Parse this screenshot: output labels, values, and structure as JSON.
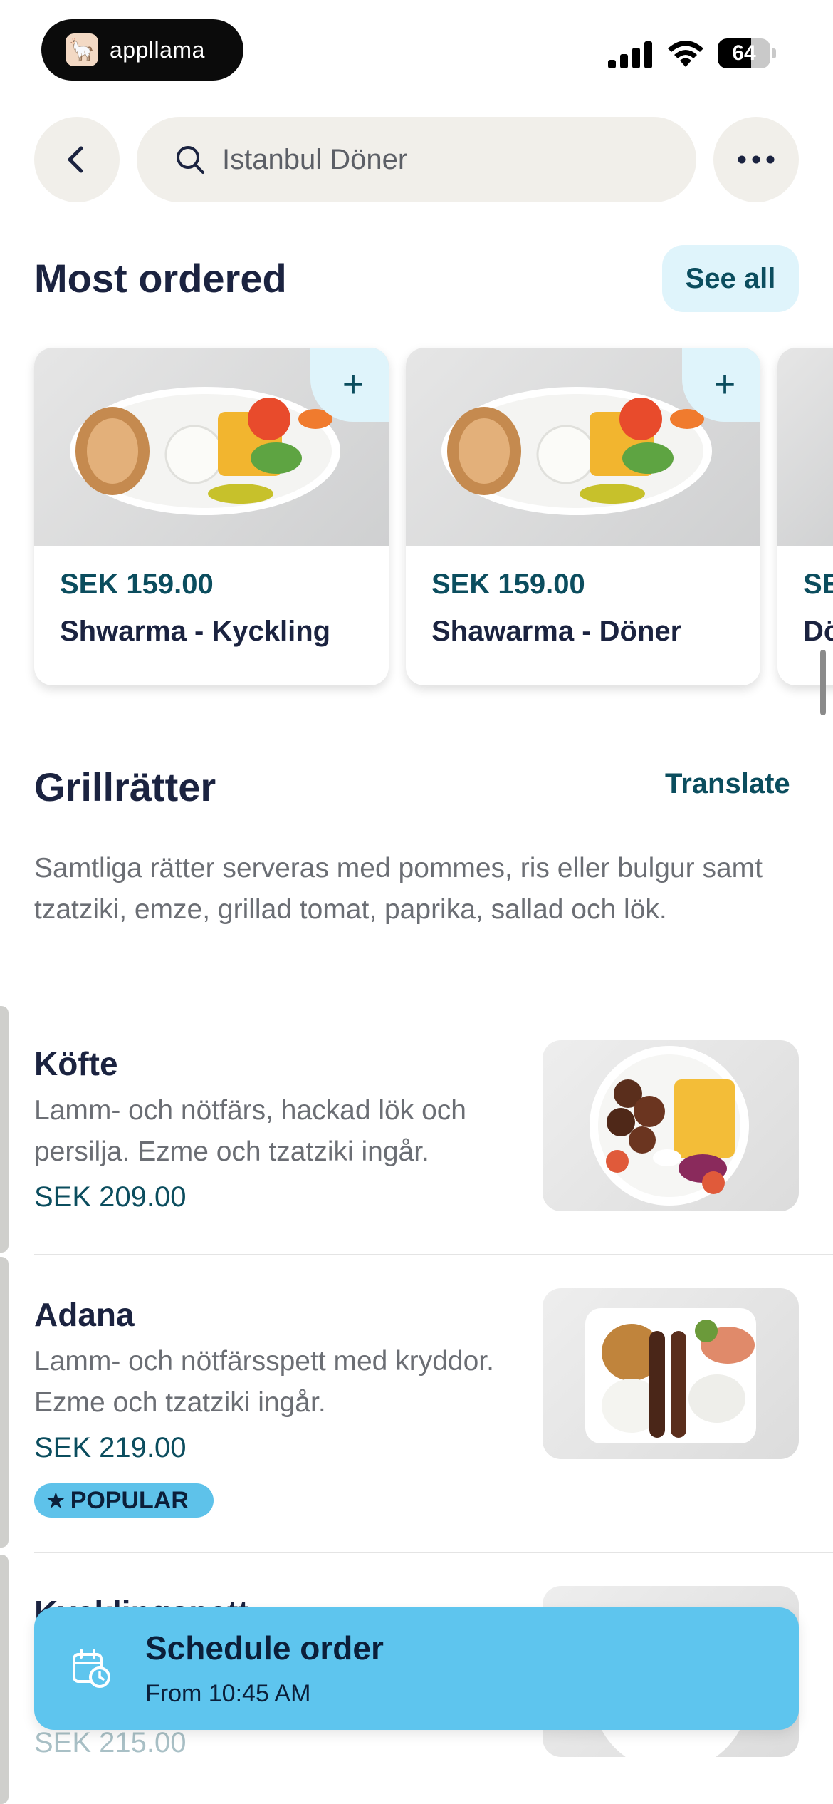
{
  "status_bar": {
    "app_badge": "appllama",
    "battery_level": "64",
    "battery_fraction": 0.64
  },
  "nav": {
    "back_icon": "chevron-left-icon",
    "search_icon": "search-icon",
    "search_text": "Istanbul Döner",
    "more_icon": "more-horizontal-icon"
  },
  "most_ordered": {
    "title": "Most ordered",
    "see_all": "See all",
    "items": [
      {
        "price": "SEK 159.00",
        "name": "Shwarma - Kyckling"
      },
      {
        "price": "SEK 159.00",
        "name": "Shawarma - Döner"
      },
      {
        "price": "SE",
        "name": "Dö"
      }
    ]
  },
  "section": {
    "title": "Grillrätter",
    "translate": "Translate",
    "description": "Samtliga rätter serveras med pommes, ris eller bulgur samt tzatziki, emze, grillad tomat, paprika, sallad och lök."
  },
  "menu_items": [
    {
      "title": "Köfte",
      "description": "Lamm- och nötfärs, hackad lök och persilja. Ezme och tzatziki ingår.",
      "price": "SEK 209.00"
    },
    {
      "title": "Adana",
      "description": "Lamm- och nötfärsspett med kryddor. Ezme och tzatziki ingår.",
      "price": "SEK 219.00",
      "badge": "POPULAR"
    },
    {
      "title": "Kycklingspett",
      "price": "SEK 215.00"
    }
  ],
  "schedule": {
    "title": "Schedule order",
    "subtitle": "From 10:45 AM",
    "icon": "calendar-clock-icon"
  },
  "colors": {
    "accent_text": "#0b4d5e",
    "schedule_bg": "#5ec5ee",
    "chip_bg": "#dff4fb"
  }
}
